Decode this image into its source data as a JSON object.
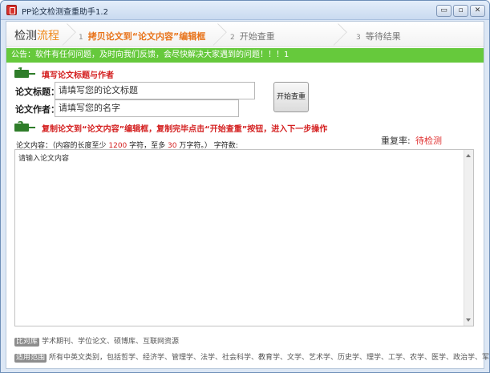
{
  "window": {
    "title": "PP论文检测查重助手1.2",
    "controls": {
      "minimize": "▭",
      "maximize": "▫",
      "close": "✕"
    }
  },
  "steps": {
    "title_main": "检测",
    "title_accent": "流程",
    "items": [
      {
        "num": "1",
        "label": "拷贝论文到“论文内容”编辑框"
      },
      {
        "num": "2",
        "label": "开始查重"
      },
      {
        "num": "3",
        "label": "等待结果"
      }
    ]
  },
  "notice": "公告：软件有任何问题，及时向我们反馈，会尽快解决大家遇到的问题！！！1",
  "section1": {
    "badge": "1",
    "title": "填写论文标题与作者"
  },
  "form": {
    "title_label": "论文标题：",
    "title_value": "请填写您的论文标题",
    "author_label": "论文作者：",
    "author_value": "请填写您的名字",
    "start_button": "开始查重"
  },
  "section2": {
    "badge": "2",
    "title": "复制论文到“论文内容”编辑框，复制完毕点击“开始查重”按钮，进入下一步操作"
  },
  "rate": {
    "label": "重复率:",
    "value": "待检测"
  },
  "content": {
    "hint_a": "论文内容：（内容的长度至少 ",
    "min_chars": "1200",
    "hint_b": " 字符，至多 ",
    "max_chars": "30",
    "hint_c": " 万字符。）  字符数:",
    "editor_text": "请输入论文内容"
  },
  "footer": {
    "row1_tag": "比对库",
    "row1_text": "学术期刊、学位论文、硕博库、互联网资源",
    "row2_tag": "适用范围",
    "row2_text": "所有中英文类别，包括哲学、经济学、管理学、法学、社会科学、教育学、文学、艺术学、历史学、理学、工学、农学、医学、政治学、军事学等。"
  },
  "colors": {
    "accent_orange": "#f08a1c",
    "notice_green": "#66c93c",
    "badge_green": "#2f7d2a",
    "warning_red": "#d42020"
  }
}
